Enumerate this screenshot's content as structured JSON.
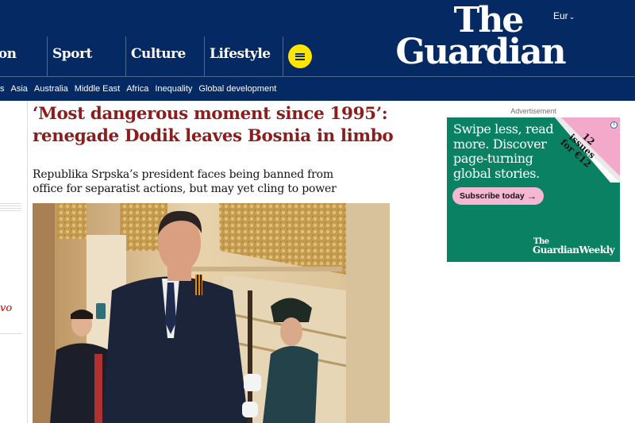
{
  "header": {
    "edition": "Eur",
    "logo_line1": "The",
    "logo_line2": "Guardian",
    "pillars": [
      "nion",
      "Sport",
      "Culture",
      "Lifestyle"
    ],
    "subnav": [
      "s",
      "Asia",
      "Australia",
      "Middle East",
      "Africa",
      "Inequality",
      "Global development"
    ]
  },
  "rail": {
    "text": "vo"
  },
  "article": {
    "headline": "‘Most dangerous moment since 1995’: renegade Dodik leaves Bosnia in limbo",
    "standfirst": "Republika Srpska’s president faces being banned from office for separatist actions, but may yet cling to power"
  },
  "ad": {
    "label": "Advertisement",
    "copy": "Swipe less, read more. Discover page-turning global stories.",
    "cta": "Subscribe today",
    "corner": "12 issues for €12",
    "brand_top": "The",
    "brand_bottom": "GuardianWeekly"
  },
  "colors": {
    "brand_navy": "#052962",
    "menu_yellow": "#ffe500",
    "headline_red": "#8d1c1c",
    "ad_green": "#0a8163",
    "ad_pink": "#f5b8d3"
  },
  "icons": [
    "chevron-down-icon",
    "menu-icon",
    "arrow-right-icon",
    "adchoices-icon"
  ]
}
